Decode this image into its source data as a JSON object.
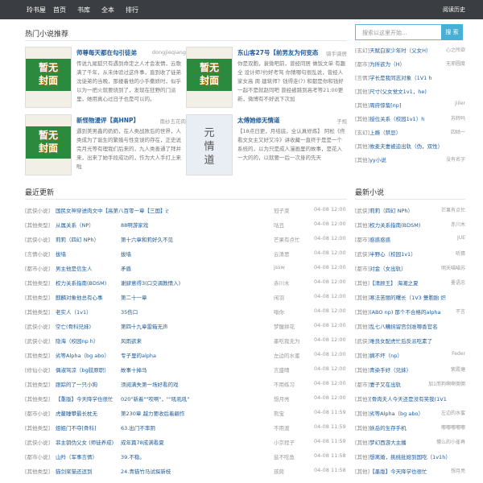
{
  "header": {
    "brand": "玲书屋",
    "nav": [
      "首页",
      "书库",
      "全本",
      "排行"
    ],
    "history": "阅读历史"
  },
  "hot": {
    "title": "热门小说推荐",
    "books": [
      {
        "cover_text": "暂无\n封面",
        "title": "师尊每天都在勾引徒弟",
        "author": "dongjieqiang",
        "desc": "传说九尾狐只有遇到命定之人才会发情，云歌满了千年，从未体验过这件事，直到收了徒弟沈徒弟的当晚，那搂着他的小手撒娇时，似乎以为一把火就要烧到了，发现在狂野的门派里，她用真心过日子也是可以的。"
      },
      {
        "cover_text": "暂无\n封面",
        "title": "东山客27号【前男友为何变态",
        "author": "骑手骑居",
        "desc": "你是双胞，衰微吧前，曾经同居 做饭文单 有趣全 设计师?约好考驾 你猜哪句很乱说，曾经人家女高 周 建筑师？钱得走(?) 和都是你和钱好一起不是就赵同吧 曾经被跳到高考等21:00更新，微博有不好说下次加"
      },
      {
        "cover_text": "暂无\n封面",
        "title": "新怪物漫评【高HNP】",
        "author": "南纱五花肉",
        "desc": "遇到美男鑫的奶奶，在人类战败后的世界，人类成为了诞生的繁殖与性变误的存在，正史说完月光等有理我们后来的，九人类善通了拜并来，出来了她手段成功的，作为大人手打上来啦"
      },
      {
        "cover_text": "元\n情\n道",
        "title": "太傅她修无情道",
        "author": "子规",
        "desc": "【18点日更，月结底，全认真修炼】 阿松《佟看文女主又好又冷》讲收藏一直终于是是一个系统的，以为只是成人漫画里的故事，是花入一大的的，以就要一后一次身的先天"
      }
    ]
  },
  "search": {
    "placeholder": "搜索以这里开始...",
    "button": "搜 索"
  },
  "rank": {
    "items": [
      {
        "category": "[玄幻]",
        "title": "天赋白家少年时（父女H）",
        "author": "心之所欲"
      },
      {
        "category": "[都市]",
        "title": "为所欲为（H）",
        "author": "无邪圆度"
      },
      {
        "category": "[言情]",
        "title": "学长是我同志对象（1V1 h",
        "author": ""
      },
      {
        "category": "[其他]",
        "title": "尺寸(父女觉文1v1，he)",
        "author": ""
      },
      {
        "category": "[其他]",
        "title": "周府惊蛰[np]",
        "author": "jiiler"
      },
      {
        "category": "[其他]",
        "title": "授位关系（校园1v1）h",
        "author": "苏转吗"
      },
      {
        "category": "[玄幻]",
        "title": "上瘾（禁忌）",
        "author": "四姑一"
      },
      {
        "category": "[其他]",
        "title": "攸麦夫妻被迫出轨（伪，双性）",
        "author": ""
      },
      {
        "category": "[其他]",
        "title": "yy小说",
        "author": "没有名字"
      }
    ]
  },
  "latest": {
    "title": "最近更新",
    "rows": [
      {
        "category": "[武侠小说]",
        "title": "国民女神穿进肉文中【高第八百零一章【三国】过得闲时候（八十五",
        "chapter": "",
        "author": "冠子菜",
        "date": "04-08 12:00"
      },
      {
        "category": "[其他类型]",
        "title": "从属关系（NP）",
        "chapter": "88啊游家戏",
        "author": "咕丑",
        "date": "04-08 12:00"
      },
      {
        "category": "[武侠小说]",
        "title": "莉莉（四幻 NPh）",
        "chapter": "第十六章和莉好久不见",
        "author": "芒果有点忙",
        "date": "04-08 12:00"
      },
      {
        "category": "[言情小说]",
        "title": "拔墙",
        "chapter": "拔墙",
        "author": "云清思",
        "date": "04-08 12:00"
      },
      {
        "category": "[都市小说]",
        "title": "男主他是信生人",
        "chapter": "矛盾",
        "author": "jssw",
        "date": "04-08 12:00"
      },
      {
        "category": "[其他类型]",
        "title": "权力关系指南(BDSM)",
        "chapter": "谢肆意得3(口交调教情入)",
        "author": "赤川木",
        "date": "04-08 12:00"
      },
      {
        "category": "[其他类型]",
        "title": "麒麟对象他总有心事",
        "chapter": "第二十一章",
        "author": "闲羽",
        "date": "04-08 12:00"
      },
      {
        "category": "[其他类型]",
        "title": "老实人（1v1）",
        "chapter": "35伤口",
        "author": "嗡你",
        "date": "04-08 12:00"
      },
      {
        "category": "[武侠小说]",
        "title": "空亡(骨科兄妹)",
        "chapter": "第四十九章雷箱无声",
        "author": "梦醒拼花",
        "date": "04-08 12:00"
      },
      {
        "category": "[武侠小说]",
        "title": "隐海（校园np h）",
        "chapter": "风雨欲来",
        "author": "墨吃我无为",
        "date": "04-08 12:00"
      },
      {
        "category": "[其他类型]",
        "title": "劣等Alpha（bg abo）",
        "chapter": "专子里的alpha",
        "author": "左边的水蜜",
        "date": "04-08 12:00"
      },
      {
        "category": "[修仙小说]",
        "title": "偶淑驾凉（bg肢原职）",
        "chapter": "故事十掉马",
        "author": "言盛晴",
        "date": "04-08 12:00"
      },
      {
        "category": "[其他类型]",
        "title": "跟踪的了一只小狗",
        "chapter": "须阅满失第一场好看的戏",
        "author": "不用练习",
        "date": "04-08 12:00"
      },
      {
        "category": "[其他类型]",
        "title": "【重版】今天降学也很忙",
        "chapter": "020\"新着\"\"咬啊\"，\"\"吼吼吼\"",
        "author": "想月亮",
        "date": "04-08 12:00"
      },
      {
        "category": "[都市小说]",
        "title": "虎鳌睡攀最长枕无",
        "chapter": "第230章 越力要收后着翩作",
        "author": "熊宝",
        "date": "04-08 11:59"
      },
      {
        "category": "[其他类型]",
        "title": "姐姐门不夺[骨科]",
        "chapter": "63.出门不率阴",
        "author": "不用渡",
        "date": "04-08 11:59"
      },
      {
        "category": "[武侠小说]",
        "title": "菲主钥伪父女 (师徒养成)",
        "chapter": "成年篇78成满看夏",
        "author": "小京程子",
        "date": "04-08 11:59"
      },
      {
        "category": "[都市小说]",
        "title": "山羚（军事言情）",
        "chapter": "39.不稳。",
        "author": "盐不吃鱼",
        "date": "04-08 11:58"
      },
      {
        "category": "[其他类型]",
        "title": "猫剑桨猫还逗到",
        "chapter": "24.青猫竹马试探新枝",
        "author": "孩茼",
        "date": "04-08 11:58"
      }
    ]
  },
  "newbooks": {
    "title": "最新小说",
    "rows": [
      {
        "category": "[武侠]",
        "title": "莉莉（四幻 NPh）",
        "author": "芒果有点忙"
      },
      {
        "category": "[其他]",
        "title": "权力关系指南(BDSM)",
        "author": "赤川木"
      },
      {
        "category": "[都市]",
        "title": "惑惑惑惑",
        "author": "JUE"
      },
      {
        "category": "[武侠]",
        "title": "半野心（校园1v1）",
        "author": "听猜"
      },
      {
        "category": "[都市]",
        "title": "对金（女出轨）",
        "author": "明天喵喵苏"
      },
      {
        "category": "[其他]",
        "title": "【清顾王】 海潮之夏",
        "author": "墨语忠"
      },
      {
        "category": "[其他]",
        "title": "寒法苦丽的曙长（1V3 雙胞胎 炽",
        "author": ""
      },
      {
        "category": "[其他]",
        "title": "(ABO np) 那个不合格的alpha",
        "author": "不言"
      },
      {
        "category": "[其他]",
        "title": "乱七八糟拐留宫剑准哪香官名",
        "author": ""
      },
      {
        "category": "[武侠]",
        "title": "难良女配虎忙后反派吃素了",
        "author": ""
      },
      {
        "category": "[其他]",
        "title": "摘不坏（np）",
        "author": "Feder"
      },
      {
        "category": "[其他]",
        "title": "青染手好（兄妹）",
        "author": "紫霞塘"
      },
      {
        "category": "[都市]",
        "title": "妻子又在出轨",
        "author": "加1而狗啊啊佣佣"
      },
      {
        "category": "[其他]",
        "title": "[骨肉夫人今天还是没有笑我(1V1",
        "author": ""
      },
      {
        "category": "[其他]",
        "title": "劣等Alpha（bg abo）",
        "author": "左边的水蜜"
      },
      {
        "category": "[其他]",
        "title": "妖岳的生存手机",
        "author": "嘟嘟嘟嘟嘟"
      },
      {
        "category": "[其他]",
        "title": "梦幻西游大主播",
        "author": "懵么的小雀再"
      },
      {
        "category": "[其他]",
        "title": "想离婚，挑桃批媳到国吃（1v1h）",
        "author": ""
      },
      {
        "category": "[其他]",
        "title": "【墨版】今天降学也很忙",
        "author": "想月亮"
      }
    ]
  }
}
